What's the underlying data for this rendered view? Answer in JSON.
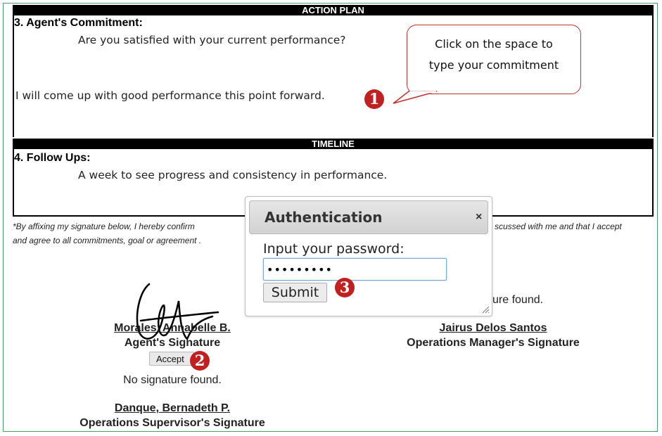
{
  "action_plan": {
    "header": "ACTION PLAN",
    "section_title": "3. Agent's Commitment:",
    "question": "Are you satisfied with your current performance?",
    "commitment_text": "I will come up with good performance this point forward."
  },
  "timeline": {
    "header": "TIMELINE",
    "section_title": "4. Follow Ups:",
    "followup_text": "A week to see progress and consistency in performance."
  },
  "callout": {
    "line1": "Click on the space to",
    "line2": "type your commitment"
  },
  "badges": {
    "one": "1",
    "two": "2",
    "three": "3"
  },
  "disclaimer": {
    "left_line1": "*By affixing my signature below, I hereby confirm",
    "right_line1": "scussed with me and that I accept",
    "line2": "and agree to all commitments, goal or agreement ."
  },
  "signatures": {
    "agent_name": "Morales, Annabelle B.",
    "agent_role": "Agent's Signature",
    "accept_label": "Accept",
    "agent_status": "No signature found.",
    "manager_status_partial": "ure found.",
    "manager_name": "Jairus Delos Santos",
    "manager_role": "Operations Manager's Signature",
    "supervisor_name": "Danque, Bernadeth P.",
    "supervisor_role": "Operations Supervisor's Signature"
  },
  "dialog": {
    "title": "Authentication",
    "close": "×",
    "password_label": "Input your password:",
    "password_value": "•••••••••",
    "submit_label": "Submit"
  },
  "colors": {
    "badge": "#c0201f",
    "callout_border": "#c0302c",
    "frame": "#4f9a6a"
  }
}
